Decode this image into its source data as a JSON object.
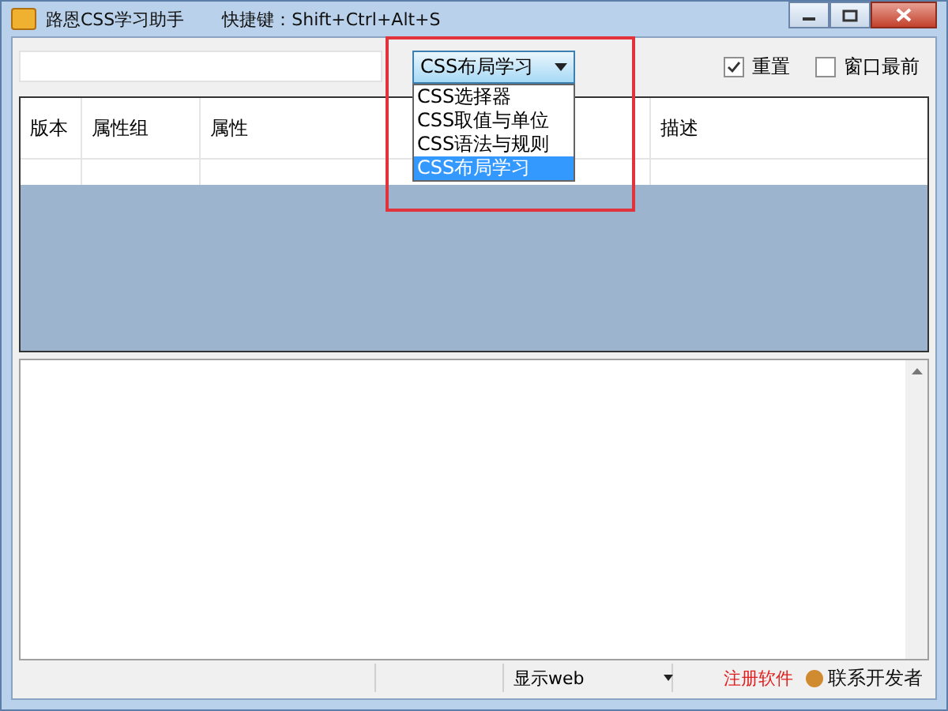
{
  "window": {
    "title": "路恩CSS学习助手",
    "hotkey": "快捷键：Shift+Ctrl+Alt+S"
  },
  "category": {
    "value": "CSS布局学习",
    "expanded": true,
    "options": [
      {
        "label": "CSS选择器",
        "selected": false
      },
      {
        "label": "CSS取值与单位",
        "selected": false
      },
      {
        "label": "CSS语法与规则",
        "selected": false
      },
      {
        "label": "CSS布局学习",
        "selected": true
      }
    ]
  },
  "options": [
    {
      "label": "重置",
      "checked": true
    },
    {
      "label": "窗口最前",
      "checked": false
    }
  ],
  "table": {
    "columns": [
      "版本",
      "属性组",
      "属性",
      "描述"
    ]
  },
  "status_bar": {
    "display": "显示web",
    "register_link": "注册软件",
    "contact": "联系开发者"
  }
}
